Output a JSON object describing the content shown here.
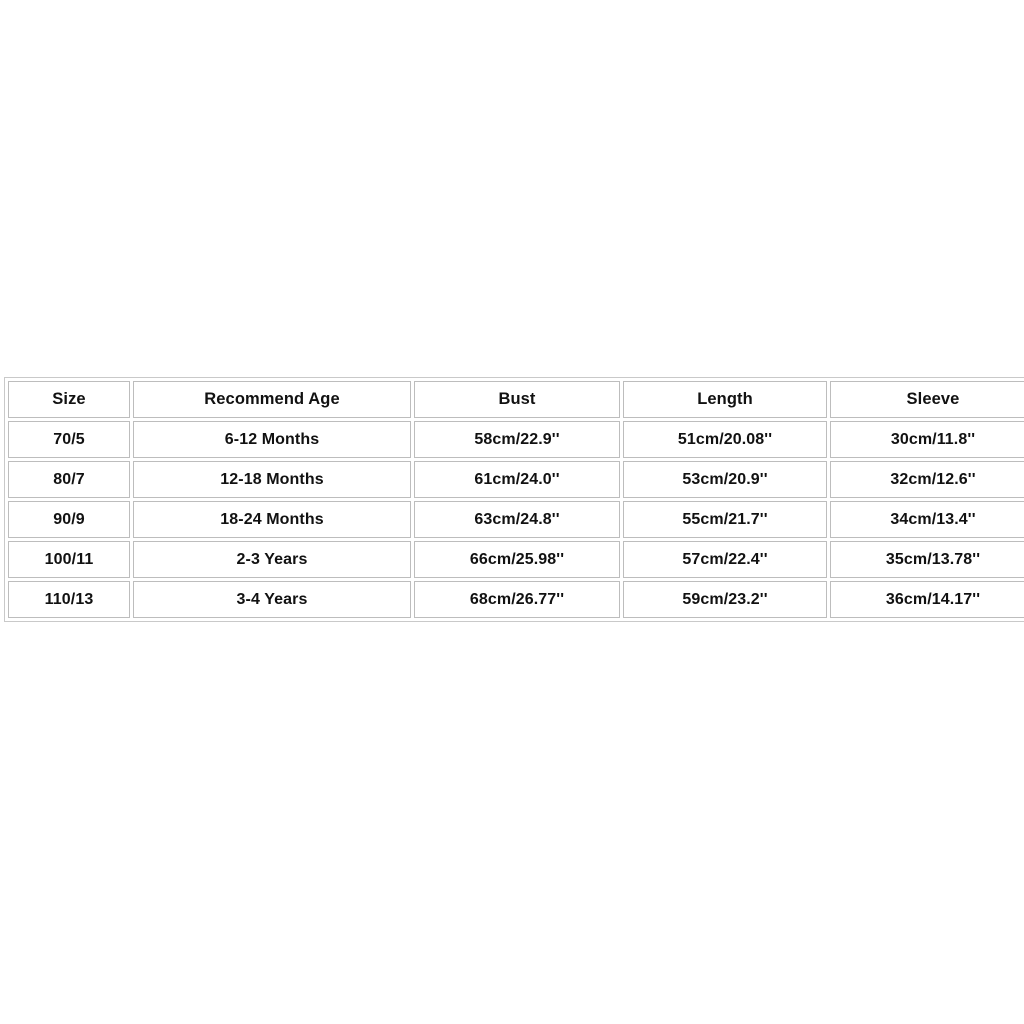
{
  "page": {
    "background_color": "#ffffff",
    "border_color": "#bdbdbd",
    "text_color": "#111111"
  },
  "size_chart": {
    "columns": [
      {
        "key": "size",
        "label": "Size"
      },
      {
        "key": "age",
        "label": "Recommend Age"
      },
      {
        "key": "bust",
        "label": "Bust"
      },
      {
        "key": "length",
        "label": "Length"
      },
      {
        "key": "sleeve",
        "label": "Sleeve"
      }
    ],
    "rows": [
      {
        "size": "70/5",
        "age": "6-12 Months",
        "bust": "58cm/22.9''",
        "length": "51cm/20.08''",
        "sleeve": "30cm/11.8''"
      },
      {
        "size": "80/7",
        "age": "12-18 Months",
        "bust": "61cm/24.0''",
        "length": "53cm/20.9''",
        "sleeve": "32cm/12.6''"
      },
      {
        "size": "90/9",
        "age": "18-24 Months",
        "bust": "63cm/24.8''",
        "length": "55cm/21.7''",
        "sleeve": "34cm/13.4''"
      },
      {
        "size": "100/11",
        "age": "2-3 Years",
        "bust": "66cm/25.98''",
        "length": "57cm/22.4''",
        "sleeve": "35cm/13.78''"
      },
      {
        "size": "110/13",
        "age": "3-4 Years",
        "bust": "68cm/26.77''",
        "length": "59cm/23.2''",
        "sleeve": "36cm/14.17''"
      }
    ]
  }
}
